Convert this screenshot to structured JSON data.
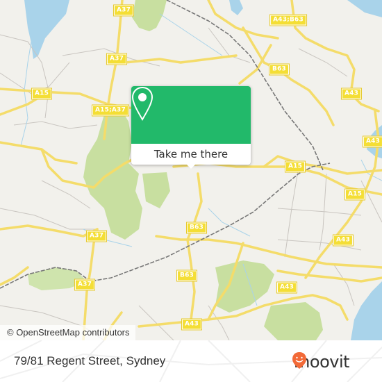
{
  "map": {
    "attribution": "© OpenStreetMap contributors",
    "road_labels": [
      {
        "text": "A37"
      },
      {
        "text": "A37"
      },
      {
        "text": "A15;A37"
      },
      {
        "text": "A15"
      },
      {
        "text": "A37"
      },
      {
        "text": "A37"
      },
      {
        "text": "A43;B63"
      },
      {
        "text": "B63"
      },
      {
        "text": "A43"
      },
      {
        "text": "A43"
      },
      {
        "text": "A15"
      },
      {
        "text": "A15"
      },
      {
        "text": "B63"
      },
      {
        "text": "B63"
      },
      {
        "text": "A43"
      },
      {
        "text": "A43"
      },
      {
        "text": "A43"
      }
    ],
    "colors": {
      "land": "#f2f1ec",
      "park": "#c8dfa0",
      "water": "#a9d3ea",
      "major_road": "#f7e47a",
      "minor_road": "#c9c5c0",
      "rail": "#707070"
    }
  },
  "popup": {
    "icon": "map-pin-icon",
    "button_label": "Take me there",
    "accent_color": "#22b96a"
  },
  "footer": {
    "address": "79/81 Regent Street, Sydney",
    "brand": "moovit",
    "brand_icon": "moovit-smiley-pin-icon",
    "brand_color": "#f26a38"
  }
}
